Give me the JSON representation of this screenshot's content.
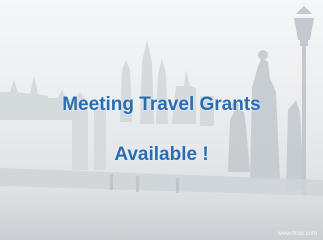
{
  "slide": {
    "headline_line1": "Meeting Travel Grants",
    "headline_line2": "Available !",
    "text_color": "#2a6db3",
    "background_subject": "faded photo of a bridge with statues and a street lamp",
    "lamp_icon": "street-lamp-icon",
    "credit": "www.flickr.com"
  }
}
